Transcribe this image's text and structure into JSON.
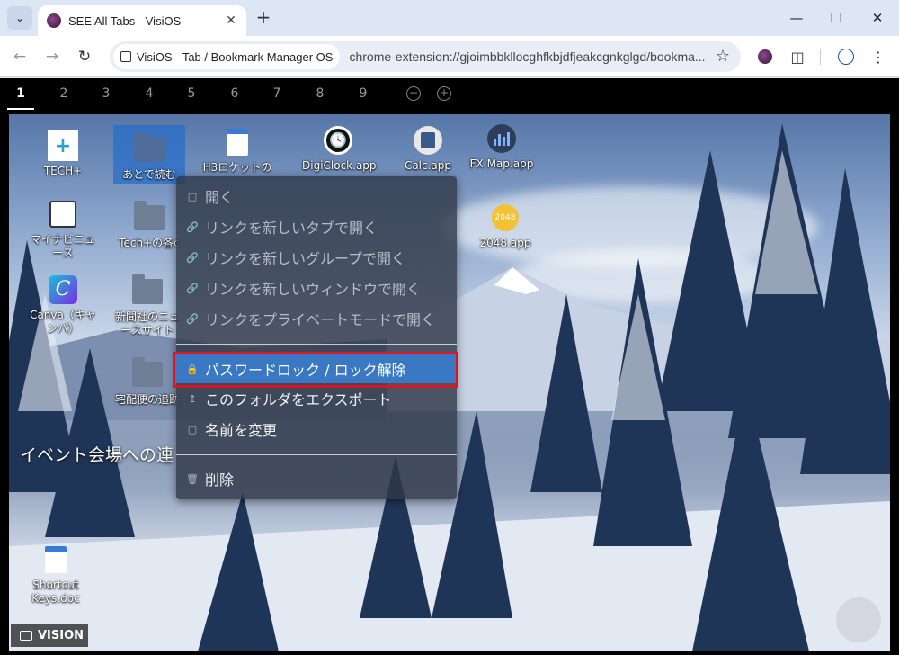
{
  "browser": {
    "tab_title": "SEE All Tabs - VisiOS",
    "site_chip": "VisiOS - Tab / Bookmark Manager OS",
    "url": "chrome-extension://gjoimbbkllocghfkbjdfjeakcgnkglgd/bookma..."
  },
  "desktops": {
    "tabs": [
      "1",
      "2",
      "3",
      "4",
      "5",
      "6",
      "7",
      "8",
      "9"
    ],
    "active": "1"
  },
  "icons": [
    {
      "label": "TECH+"
    },
    {
      "label": "あとで読む"
    },
    {
      "label": "H3ロケットの"
    },
    {
      "label": "DigiClock.app"
    },
    {
      "label": "Calc.app"
    },
    {
      "label": "FX Map.app"
    },
    {
      "label": "マイナビニュース"
    },
    {
      "label": "Tech+の各c"
    },
    {
      "label": "2048.app"
    },
    {
      "label": "Canva（キャンバ）"
    },
    {
      "label": "新聞社のニュースサイト"
    },
    {
      "label": "宅配便の追跡"
    },
    {
      "label": "Shortcut Keys.doc"
    }
  ],
  "section_title": "イベント会場への連",
  "context_menu": [
    {
      "label": "開く"
    },
    {
      "label": "リンクを新しいタブで開く"
    },
    {
      "label": "リンクを新しいグループで開く"
    },
    {
      "label": "リンクを新しいウィンドウで開く"
    },
    {
      "label": "リンクをプライベートモードで開く"
    },
    {
      "label": "パスワードロック / ロック解除"
    },
    {
      "label": "このフォルダをエクスポート"
    },
    {
      "label": "名前を変更"
    },
    {
      "label": "削除"
    }
  ],
  "vision_button": "VISION",
  "icon_2048_text": "2048"
}
